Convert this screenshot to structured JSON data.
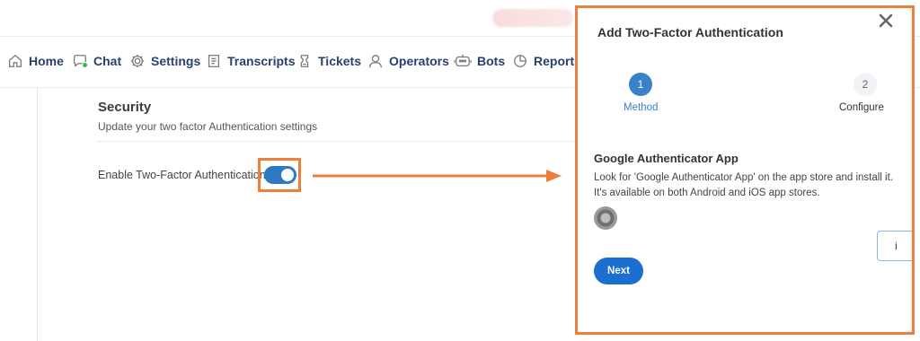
{
  "nav": {
    "items": [
      {
        "label": "Home",
        "icon": "home-icon"
      },
      {
        "label": "Chat",
        "icon": "chat-icon"
      },
      {
        "label": "Settings",
        "icon": "gear-icon"
      },
      {
        "label": "Transcripts",
        "icon": "document-icon"
      },
      {
        "label": "Tickets",
        "icon": "ticket-icon"
      },
      {
        "label": "Operators",
        "icon": "user-icon"
      },
      {
        "label": "Bots",
        "icon": "bot-icon"
      },
      {
        "label": "Reports",
        "icon": "pie-chart-icon"
      }
    ]
  },
  "security": {
    "title": "Security",
    "subtitle": "Update your two factor Authentication settings",
    "toggle_label": "Enable Two-Factor Authentication",
    "toggle_on": true
  },
  "modal": {
    "title": "Add Two-Factor Authentication",
    "close_glyph": "×",
    "steps": [
      {
        "number": "1",
        "label": "Method",
        "active": true
      },
      {
        "number": "2",
        "label": "Configure",
        "active": false
      }
    ],
    "app_title": "Google Authenticator App",
    "desc_line1": "Look for 'Google Authenticator App' on the app store and install it.",
    "desc_line2": "It's available on both Android and iOS app stores.",
    "side_box_text": "i",
    "next_label": "Next"
  },
  "colors": {
    "accent": "#2f78c4",
    "highlight": "#ee7f3a",
    "nav_text": "#2a3f6f",
    "button": "#1a6fd0"
  }
}
